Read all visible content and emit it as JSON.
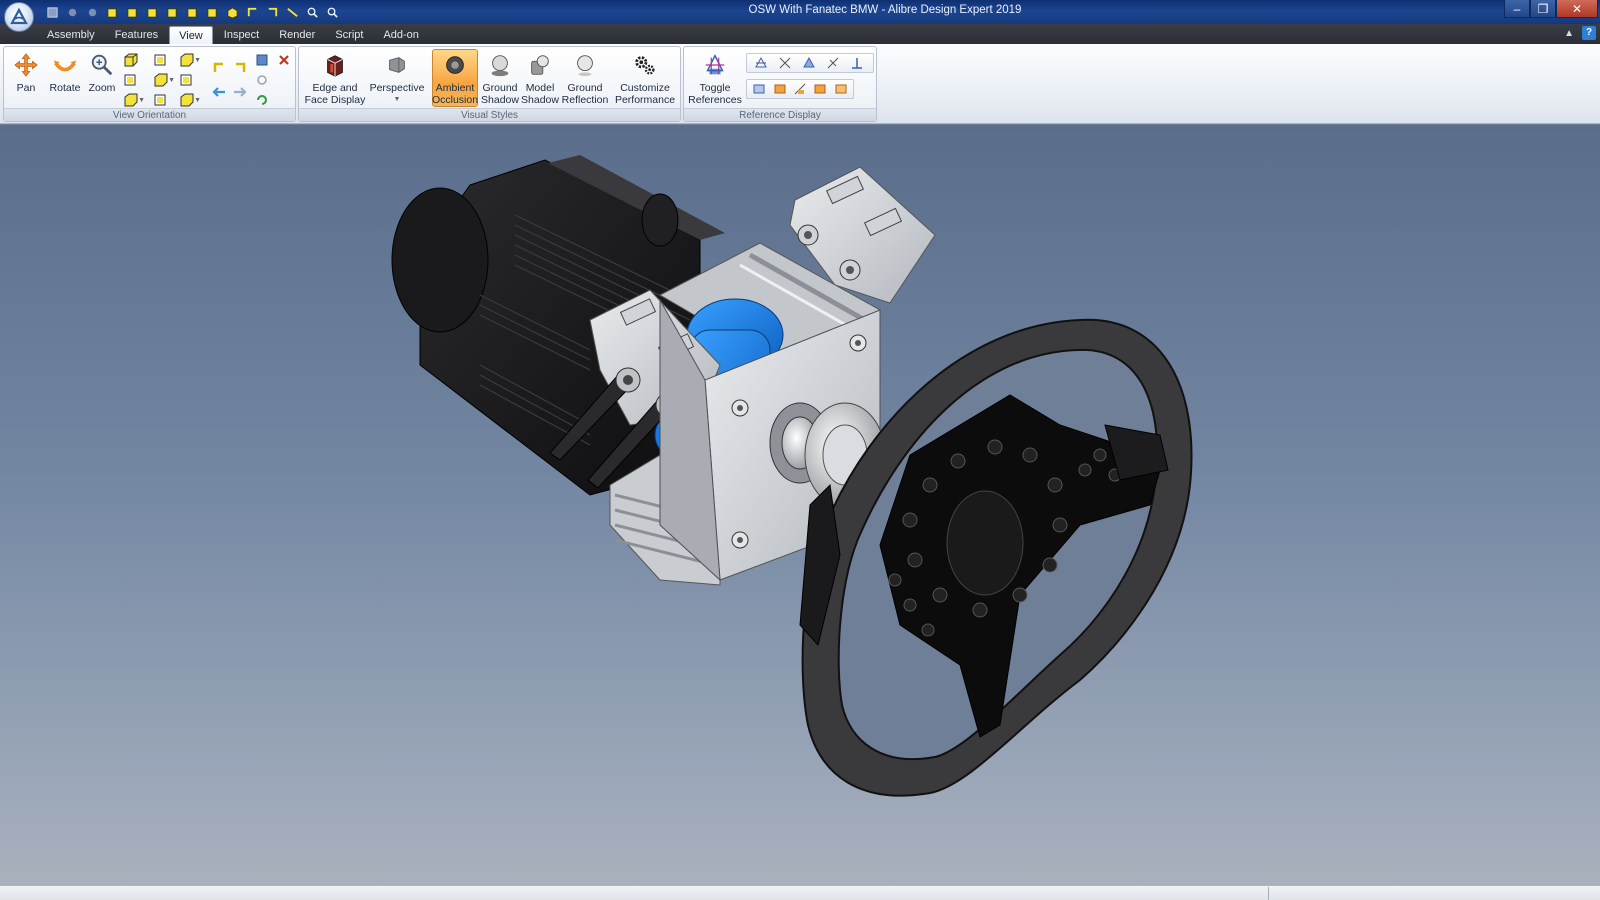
{
  "window": {
    "title": "OSW With Fanatec BMW - Alibre Design Expert 2019",
    "controls": {
      "minimize": "–",
      "restore": "❐",
      "close": "✕"
    }
  },
  "tabs": [
    {
      "label": "Assembly",
      "active": false
    },
    {
      "label": "Features",
      "active": false
    },
    {
      "label": "View",
      "active": true
    },
    {
      "label": "Inspect",
      "active": false
    },
    {
      "label": "Render",
      "active": false
    },
    {
      "label": "Script",
      "active": false
    },
    {
      "label": "Add-on",
      "active": false
    }
  ],
  "help_label": "?",
  "ribbon": {
    "view_orientation": {
      "label": "View Orientation",
      "pan": "Pan",
      "rotate": "Rotate",
      "zoom": "Zoom"
    },
    "visual_styles": {
      "label": "Visual Styles",
      "edge_face_line1": "Edge and",
      "edge_face_line2": "Face Display",
      "perspective": "Perspective",
      "ambient_line1": "Ambient",
      "ambient_line2": "Occlusion",
      "ground_shadow_line1": "Ground",
      "ground_shadow_line2": "Shadow",
      "model_shadow_line1": "Model",
      "model_shadow_line2": "Shadow",
      "ground_reflection_line1": "Ground",
      "ground_reflection_line2": "Reflection",
      "customize_line1": "Customize",
      "customize_line2": "Performance"
    },
    "reference_display": {
      "label": "Reference Display",
      "toggle_line1": "Toggle",
      "toggle_line2": "References"
    }
  },
  "colors": {
    "accent_active": "#f7a540",
    "motor_blue": "#1f7fe0",
    "model_black": "#1a1a1c"
  }
}
